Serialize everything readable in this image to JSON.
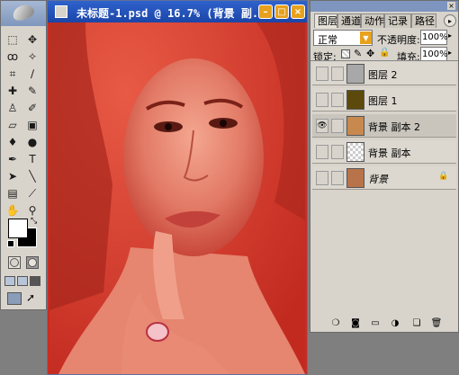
{
  "document": {
    "title": "未标题-1.psd @ 16.7% (背景 副...",
    "controls": {
      "minimize": "–",
      "maximize": "□",
      "close": "×"
    }
  },
  "toolbox": {
    "tools": [
      {
        "name": "marquee-tool-icon",
        "glyph": "⬚"
      },
      {
        "name": "move-tool-icon",
        "glyph": "✥"
      },
      {
        "name": "lasso-tool-icon",
        "glyph": "ꝏ"
      },
      {
        "name": "magic-wand-tool-icon",
        "glyph": "✧"
      },
      {
        "name": "crop-tool-icon",
        "glyph": "⌗"
      },
      {
        "name": "slice-tool-icon",
        "glyph": "∕"
      },
      {
        "name": "healing-brush-tool-icon",
        "glyph": "✚"
      },
      {
        "name": "brush-tool-icon",
        "glyph": "✎"
      },
      {
        "name": "clone-stamp-tool-icon",
        "glyph": "♙"
      },
      {
        "name": "history-brush-tool-icon",
        "glyph": "✐"
      },
      {
        "name": "eraser-tool-icon",
        "glyph": "▱"
      },
      {
        "name": "gradient-tool-icon",
        "glyph": "▣"
      },
      {
        "name": "blur-tool-icon",
        "glyph": "♦"
      },
      {
        "name": "dodge-tool-icon",
        "glyph": "●"
      },
      {
        "name": "pen-tool-icon",
        "glyph": "✒"
      },
      {
        "name": "type-tool-icon",
        "glyph": "T"
      },
      {
        "name": "path-selection-tool-icon",
        "glyph": "➤"
      },
      {
        "name": "line-tool-icon",
        "glyph": "╲"
      },
      {
        "name": "notes-tool-icon",
        "glyph": "▤"
      },
      {
        "name": "eyedropper-tool-icon",
        "glyph": "⟋"
      },
      {
        "name": "hand-tool-icon",
        "glyph": "✋"
      },
      {
        "name": "zoom-tool-icon",
        "glyph": "⚲"
      }
    ]
  },
  "layers_panel": {
    "tabs": [
      "图层",
      "通道",
      "动作",
      "记录",
      "路径"
    ],
    "blend_mode": "正常",
    "opacity_label": "不透明度:",
    "opacity_value": "100%",
    "lock_label": "锁定:",
    "fill_label": "填充:",
    "fill_value": "100%",
    "layers": [
      {
        "name": "图层 2",
        "visible": false,
        "selected": false,
        "thumb": "#a8a8a8"
      },
      {
        "name": "图层 1",
        "visible": false,
        "selected": false,
        "thumb": "#5c4a0c"
      },
      {
        "name": "背景 副本 2",
        "visible": true,
        "selected": true,
        "thumb": "#c8894f"
      },
      {
        "name": "背景 副本",
        "visible": false,
        "selected": false,
        "thumb": "checker"
      },
      {
        "name": "背景",
        "visible": false,
        "selected": false,
        "thumb": "#b8734a",
        "locked": true
      }
    ]
  },
  "colors": {
    "title_bar": "#1b45a8",
    "canvas_tint": "#d8392d",
    "panel_bg": "#d8d4cc",
    "workspace_bg": "#7f7f7f"
  }
}
